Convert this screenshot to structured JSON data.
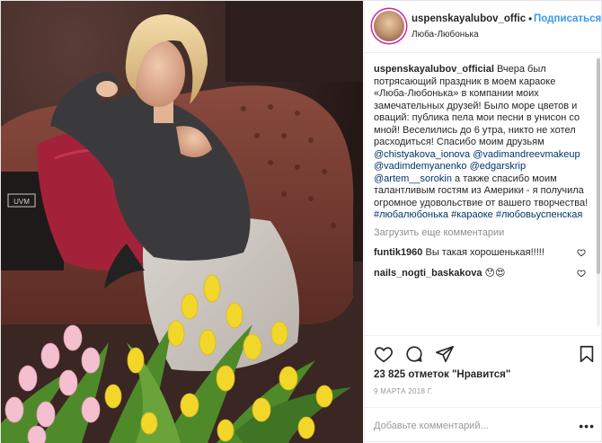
{
  "photo": {
    "alt_icons": [
      "tulip-bouquet",
      "sofa",
      "pillow",
      "bag"
    ],
    "bag_text": "UVM",
    "colors": {
      "tulip_yellow": "#f2d62a",
      "tulip_pink": "#f4bfcf",
      "leaf_green": "#4f8a2a",
      "sofa": "#7a3f36",
      "pillow": "#b3263a"
    }
  },
  "header": {
    "username": "uspenskayalubov_offic",
    "dot": "•",
    "follow_label": "Подписаться",
    "location": "Люба-Любонька"
  },
  "caption": {
    "username": "uspenskayalubov_official",
    "text_1": " Вчера был потрясающий праздник в моем караоке «Люба-Любонька» в компании моих замечательных друзей! Было море цветов и оваций: публика пела мои песни в унисон со мной! Веселились до 6 утра, никто не хотел расходиться! Спасибо моим друзьям ",
    "mention_1": "@chistyakova_ionova",
    "mention_2": "@vadimandreevmakeup",
    "mention_3": "@vadimdemyanenko",
    "mention_4": "@edgarskrip",
    "mention_5": "@artem__sorokin",
    "text_2": " а также спасибо моим талантливым гостям из Америки - я получила огромное удовольствие от вашего творчества! ",
    "hashtag_1": "#любалюбонька",
    "hashtag_2": "#караоке",
    "hashtag_3": "#любовьуспенская"
  },
  "load_more": "Загрузить еще комментарии",
  "comments": [
    {
      "user": "funtik1960",
      "text": " Вы такая хорошенькая!!!!!"
    },
    {
      "user": "nails_nogti_baskakova",
      "text": " 😯😍"
    }
  ],
  "likes": "23 825 отметок \"Нравится\"",
  "date": "9 МАРТА 2018 Г.",
  "add_comment": {
    "placeholder": "Добавьте комментарий...",
    "more": "•••"
  },
  "icons": [
    "heart-icon",
    "comment-icon",
    "share-icon",
    "bookmark-icon"
  ],
  "accent": "#3897f0"
}
